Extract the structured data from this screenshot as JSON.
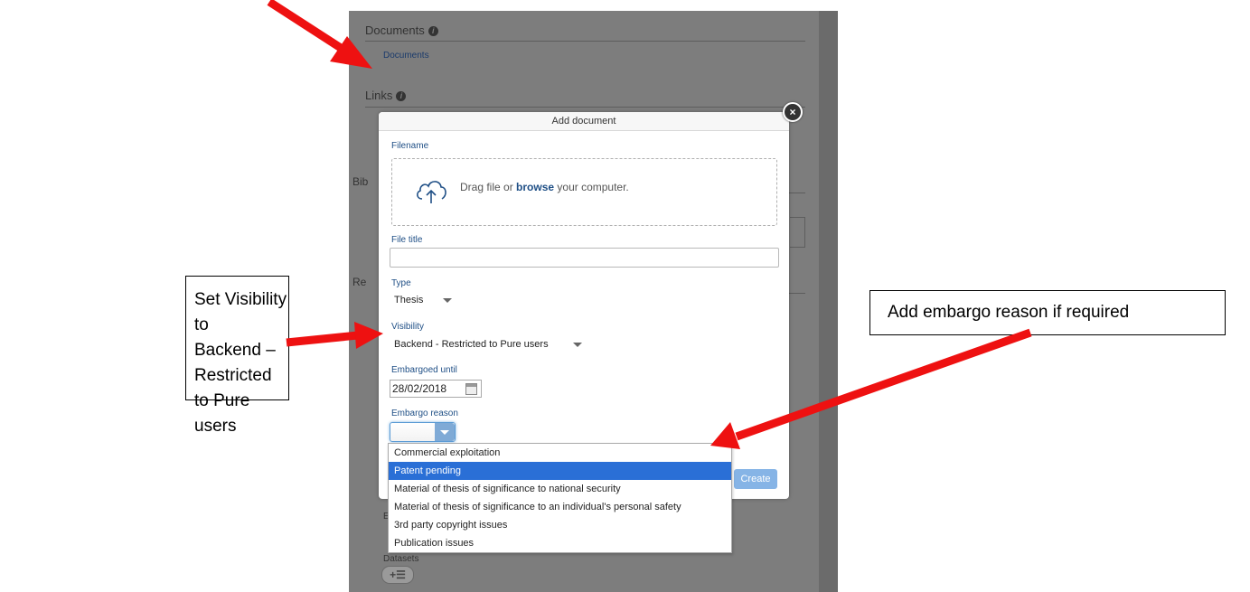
{
  "background_page": {
    "sections": [
      "Documents",
      "Links"
    ],
    "documents_link": "Documents",
    "partial_labels": [
      "Bib",
      "Re"
    ],
    "e_label": "E",
    "datasets_label": "Datasets",
    "datasets_button": "+☰"
  },
  "modal": {
    "title": "Add document",
    "close_icon": "×",
    "filename_label": "Filename",
    "dropzone": {
      "text_before": "Drag file or",
      "browse_link": "browse",
      "text_after": "your computer."
    },
    "file_title_label": "File title",
    "file_title_value": "",
    "type_label": "Type",
    "type_value": "Thesis",
    "visibility_label": "Visibility",
    "visibility_value": "Backend - Restricted to Pure users",
    "embargoed_until_label": "Embargoed until",
    "embargoed_until_value": "28/02/2018",
    "embargo_reason_label": "Embargo reason",
    "embargo_reason_value": "",
    "embargo_reason_options": [
      "Commercial exploitation",
      "Patent pending",
      "Material of thesis of significance to national security",
      "Material of thesis of significance to an individual's personal safety",
      "3rd party copyright issues",
      "Publication issues"
    ],
    "embargo_reason_highlighted": "Patent pending",
    "create_button": "Create"
  },
  "callouts": {
    "left_lines": [
      "Set Visibility to",
      "Backend – Restricted",
      "to Pure users"
    ],
    "right": "Add embargo reason if required"
  },
  "colors": {
    "arrow": "#ee1111",
    "dim_background": "#7d7d7d",
    "highlight": "#2a6fd6",
    "create_button": "#86b4e6",
    "label": "#1f4f86"
  }
}
